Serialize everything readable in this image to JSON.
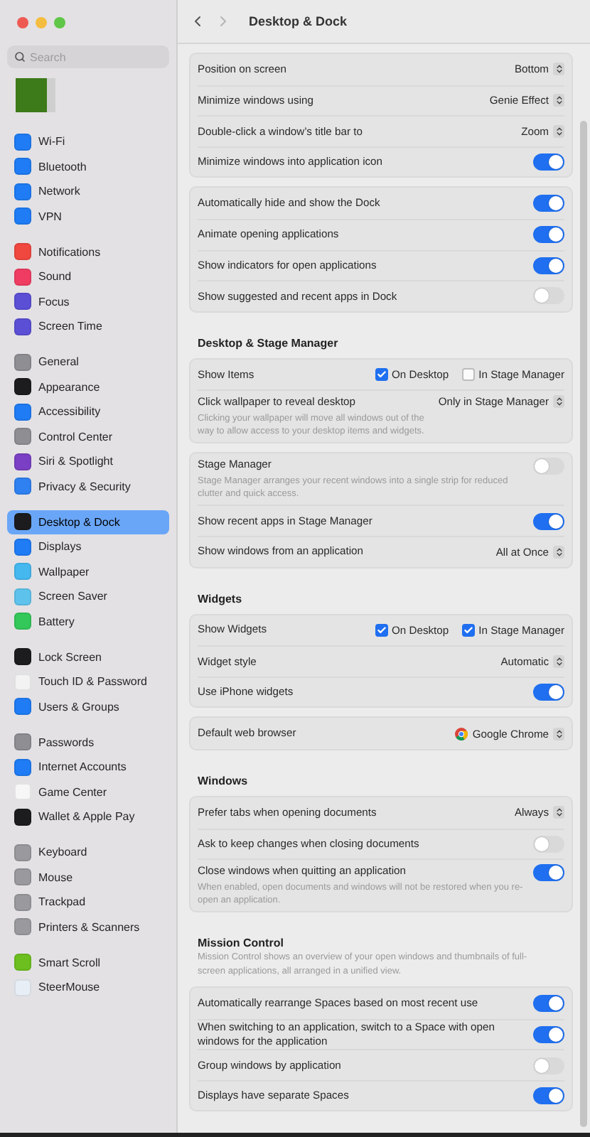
{
  "sidebar": {
    "search": {
      "placeholder": "Search"
    },
    "groups": [
      [
        {
          "label": "Wi-Fi",
          "selected": false,
          "color": "#1f7cf5"
        },
        {
          "label": "Bluetooth",
          "selected": false,
          "color": "#1f7cf5"
        },
        {
          "label": "Network",
          "selected": false,
          "color": "#1f7cf5"
        },
        {
          "label": "VPN",
          "selected": false,
          "color": "#1f7cf5"
        }
      ],
      [
        {
          "label": "Notifications",
          "selected": false,
          "color": "#f0473f"
        },
        {
          "label": "Sound",
          "selected": false,
          "color": "#f03c62"
        },
        {
          "label": "Focus",
          "selected": false,
          "color": "#5b4fd6"
        },
        {
          "label": "Screen Time",
          "selected": false,
          "color": "#5b4fd6"
        }
      ],
      [
        {
          "label": "General",
          "selected": false,
          "color": "#8e8e93"
        },
        {
          "label": "Appearance",
          "selected": false,
          "color": "#1c1c1e"
        },
        {
          "label": "Accessibility",
          "selected": false,
          "color": "#1f7cf5"
        },
        {
          "label": "Control Center",
          "selected": false,
          "color": "#8e8e93"
        },
        {
          "label": "Siri & Spotlight",
          "selected": false,
          "color": "#7a3fc4"
        },
        {
          "label": "Privacy & Security",
          "selected": false,
          "color": "#2f80f0"
        }
      ],
      [
        {
          "label": "Desktop & Dock",
          "selected": true,
          "color": "#1c1c1e"
        },
        {
          "label": "Displays",
          "selected": false,
          "color": "#1f7cf5"
        },
        {
          "label": "Wallpaper",
          "selected": false,
          "color": "#45b8f0"
        },
        {
          "label": "Screen Saver",
          "selected": false,
          "color": "#5ec3ec"
        },
        {
          "label": "Battery",
          "selected": false,
          "color": "#34c759"
        }
      ],
      [
        {
          "label": "Lock Screen",
          "selected": false,
          "color": "#1c1c1e"
        },
        {
          "label": "Touch ID & Password",
          "selected": false,
          "color": "#f3f3f3"
        },
        {
          "label": "Users & Groups",
          "selected": false,
          "color": "#1f7cf5"
        }
      ],
      [
        {
          "label": "Passwords",
          "selected": false,
          "color": "#8e8e93"
        },
        {
          "label": "Internet Accounts",
          "selected": false,
          "color": "#1f7cf5"
        },
        {
          "label": "Game Center",
          "selected": false,
          "color": "#f7f7f7"
        },
        {
          "label": "Wallet & Apple Pay",
          "selected": false,
          "color": "#1c1c1e"
        }
      ],
      [
        {
          "label": "Keyboard",
          "selected": false,
          "color": "#9a9a9e"
        },
        {
          "label": "Mouse",
          "selected": false,
          "color": "#9a9a9e"
        },
        {
          "label": "Trackpad",
          "selected": false,
          "color": "#9a9a9e"
        },
        {
          "label": "Printers & Scanners",
          "selected": false,
          "color": "#9a9a9e"
        }
      ],
      [
        {
          "label": "Smart Scroll",
          "selected": false,
          "color": "#6cbf1e"
        },
        {
          "label": "SteerMouse",
          "selected": false,
          "color": "#e8eef5"
        }
      ]
    ]
  },
  "header": {
    "title": "Desktop & Dock"
  },
  "sections": [
    {
      "cards": [
        [
          {
            "kind": "popup",
            "label": "Position on screen",
            "value": "Bottom"
          },
          {
            "kind": "popup",
            "label": "Minimize windows using",
            "value": "Genie Effect"
          },
          {
            "kind": "popup",
            "label": "Double-click a window’s title bar to",
            "value": "Zoom"
          },
          {
            "kind": "toggle",
            "label": "Minimize windows into application icon",
            "on": true
          }
        ],
        [
          {
            "kind": "toggle",
            "label": "Automatically hide and show the Dock",
            "on": true
          },
          {
            "kind": "toggle",
            "label": "Animate opening applications",
            "on": true
          },
          {
            "kind": "toggle",
            "label": "Show indicators for open applications",
            "on": true
          },
          {
            "kind": "toggle",
            "label": "Show suggested and recent apps in Dock",
            "on": false
          }
        ]
      ]
    },
    {
      "heading": "Desktop & Stage Manager",
      "cards": [
        [
          {
            "kind": "checks",
            "label": "Show Items",
            "options": [
              {
                "label": "On Desktop",
                "checked": true
              },
              {
                "label": "In Stage Manager",
                "checked": false
              }
            ]
          },
          {
            "kind": "popup",
            "label": "Click wallpaper to reveal desktop",
            "value": "Only in Stage Manager",
            "description": "Clicking your wallpaper will move all windows out of the way to allow access to your desktop items and widgets."
          }
        ],
        [
          {
            "kind": "toggle",
            "label": "Stage Manager",
            "on": false,
            "description": "Stage Manager arranges your recent windows into a single strip for reduced clutter and quick access."
          },
          {
            "kind": "toggle",
            "label": "Show recent apps in Stage Manager",
            "on": true
          },
          {
            "kind": "popup",
            "label": "Show windows from an application",
            "value": "All at Once"
          }
        ]
      ]
    },
    {
      "heading": "Widgets",
      "cards": [
        [
          {
            "kind": "checks",
            "label": "Show Widgets",
            "options": [
              {
                "label": "On Desktop",
                "checked": true
              },
              {
                "label": "In Stage Manager",
                "checked": true
              }
            ]
          },
          {
            "kind": "popup",
            "label": "Widget style",
            "value": "Automatic"
          },
          {
            "kind": "toggle",
            "label": "Use iPhone widgets",
            "on": true
          }
        ],
        [
          {
            "kind": "browser",
            "label": "Default web browser",
            "value": "Google Chrome"
          }
        ]
      ]
    },
    {
      "heading": "Windows",
      "cards": [
        [
          {
            "kind": "popup",
            "label": "Prefer tabs when opening documents",
            "value": "Always"
          },
          {
            "kind": "toggle",
            "label": "Ask to keep changes when closing documents",
            "on": false
          },
          {
            "kind": "toggle",
            "label": "Close windows when quitting an application",
            "on": true,
            "description": "When enabled, open documents and windows will not be restored when you re-open an application."
          }
        ]
      ]
    },
    {
      "heading": "Mission Control",
      "description": "Mission Control shows an overview of your open windows and thumbnails of full-screen applications, all arranged in a unified view.",
      "cards": [
        [
          {
            "kind": "toggle",
            "label": "Automatically rearrange Spaces based on most recent use",
            "on": true
          },
          {
            "kind": "toggle",
            "label": "When switching to an application, switch to a Space with open windows for the application",
            "on": true
          },
          {
            "kind": "toggle",
            "label": "Group windows by application",
            "on": false
          },
          {
            "kind": "toggle",
            "label": "Displays have separate Spaces",
            "on": true
          }
        ]
      ]
    }
  ]
}
